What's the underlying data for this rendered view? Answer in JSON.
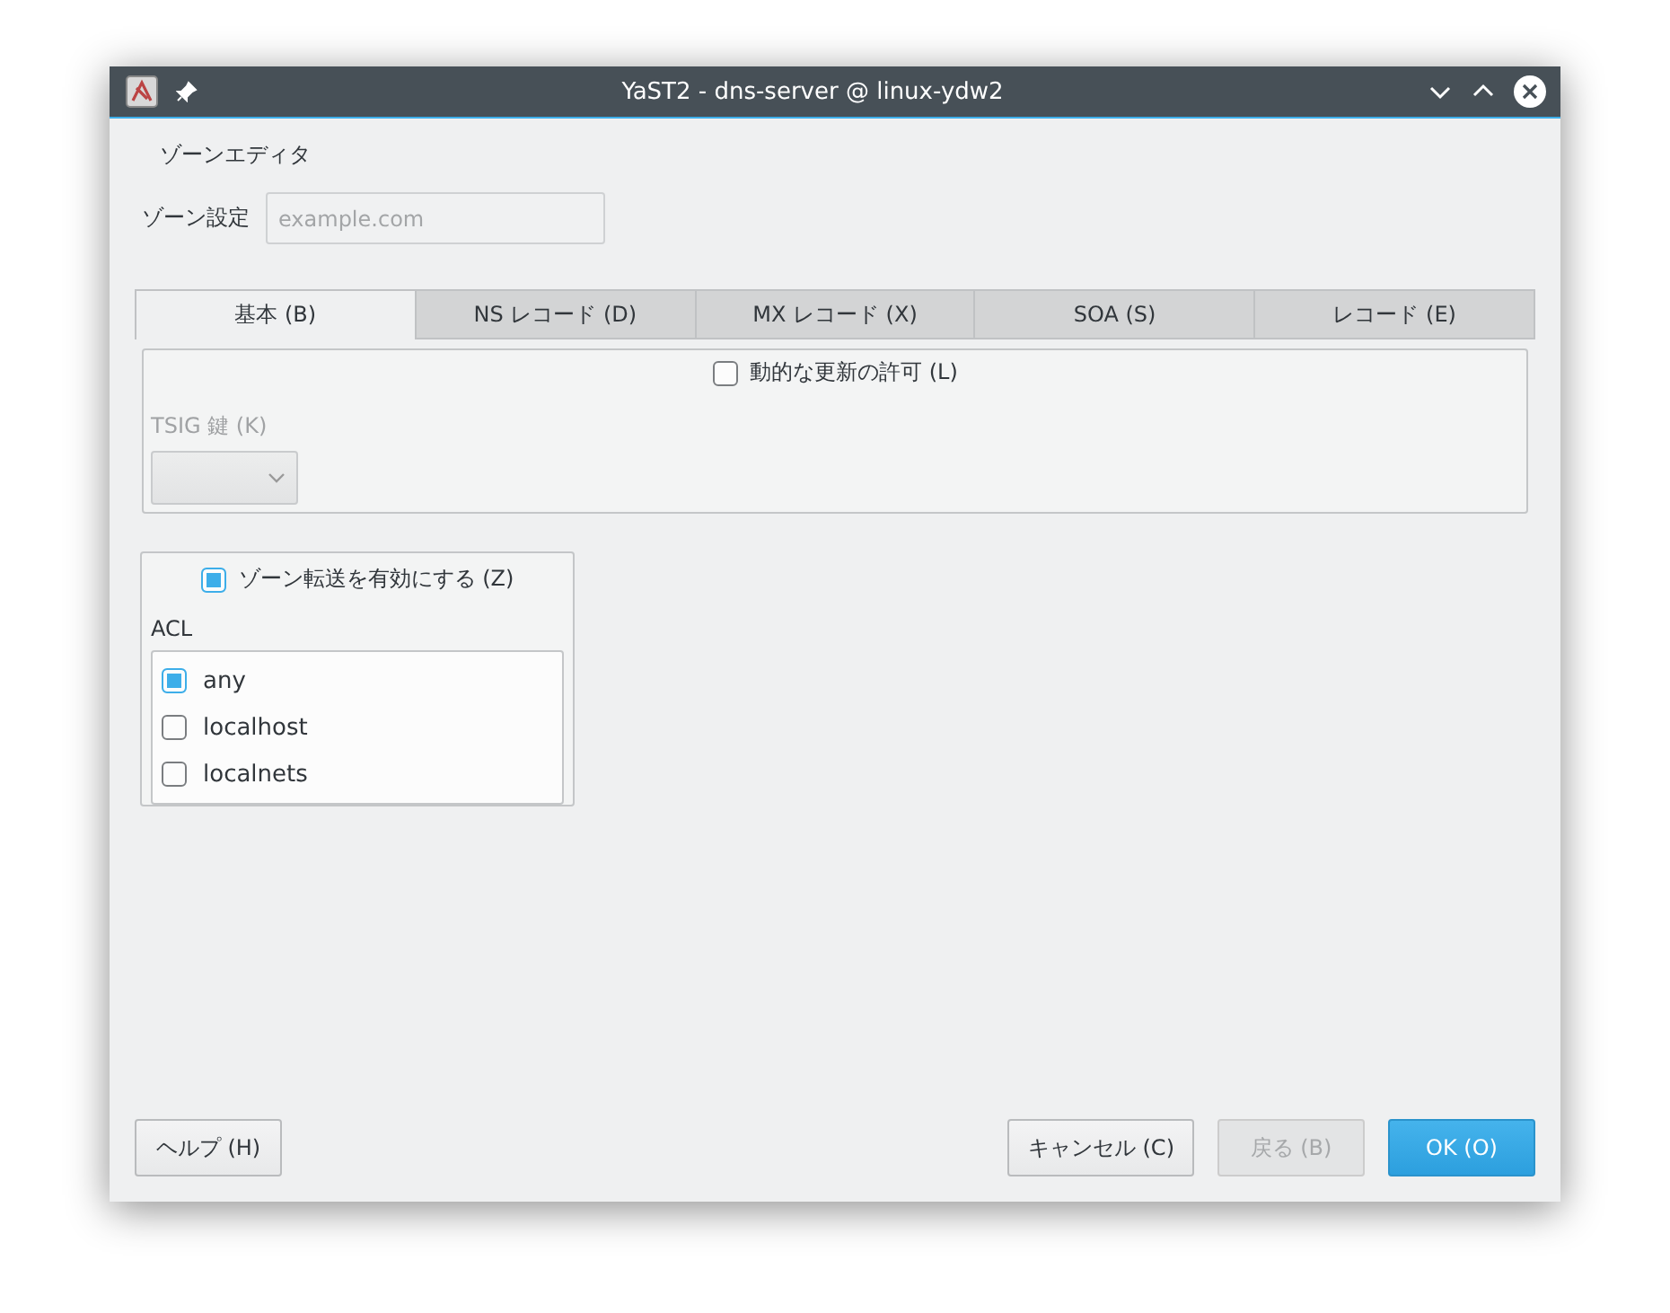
{
  "window": {
    "title": "YaST2 - dns-server @ linux-ydw2"
  },
  "heading": "ゾーンエディタ",
  "zone_field": {
    "label": "ゾーン設定",
    "placeholder": "example.com",
    "disabled": true
  },
  "tabs": [
    {
      "label": "基本 (B)",
      "selected": true
    },
    {
      "label": "NS レコード (D)",
      "selected": false
    },
    {
      "label": "MX レコード (X)",
      "selected": false
    },
    {
      "label": "SOA (S)",
      "selected": false
    },
    {
      "label": "レコード (E)",
      "selected": false
    }
  ],
  "dynamic_update": {
    "label": "動的な更新の許可 (L)",
    "checked": false
  },
  "tsig": {
    "label": "TSIG 鍵 (K)",
    "disabled": true
  },
  "zone_transfer": {
    "label": "ゾーン転送を有効にする (Z)",
    "checked": true
  },
  "acl": {
    "label": "ACL",
    "items": [
      {
        "label": "any",
        "checked": true
      },
      {
        "label": "localhost",
        "checked": false
      },
      {
        "label": "localnets",
        "checked": false
      }
    ]
  },
  "buttons": [
    {
      "label": "ヘルプ (H)",
      "disabled": false,
      "default": false
    },
    {
      "label": "キャンセル (C)",
      "disabled": false,
      "default": false
    },
    {
      "label": "戻る (B)",
      "disabled": true,
      "default": false
    },
    {
      "label": "OK (O)",
      "disabled": false,
      "default": true
    }
  ]
}
